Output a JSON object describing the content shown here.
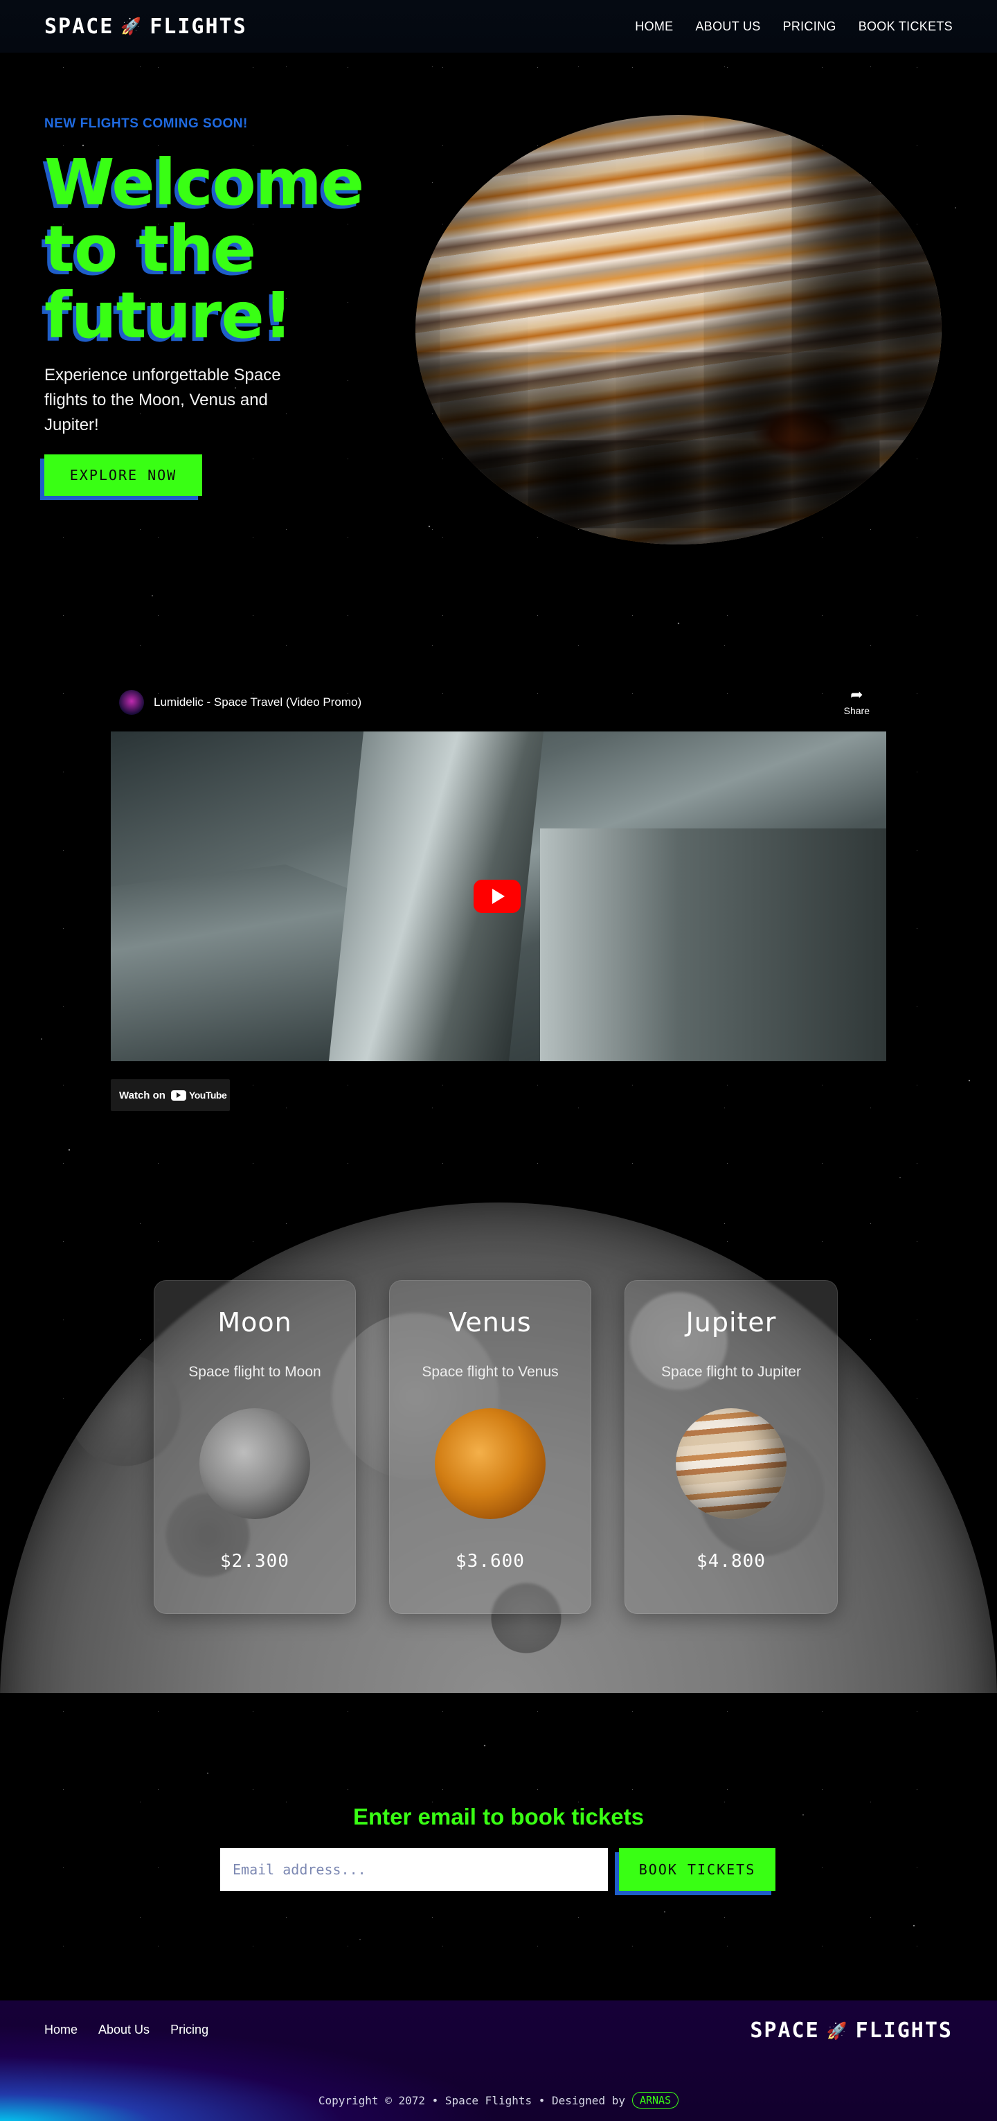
{
  "header": {
    "logo_left": "SPACE",
    "logo_right": "FLIGHTS",
    "logo_icon": "rocket-icon",
    "nav": [
      "HOME",
      "ABOUT US",
      "PRICING",
      "BOOK TICKETS"
    ]
  },
  "hero": {
    "eyebrow": "NEW FLIGHTS COMING SOON!",
    "title": "Welcome to the future!",
    "subtitle": "Experience unforgettable Space flights to the Moon, Venus and Jupiter!",
    "cta": "EXPLORE NOW"
  },
  "video": {
    "title": "Lumidelic - Space Travel (Video Promo)",
    "share": "Share",
    "watch_on": "Watch on",
    "youtube": "YouTube"
  },
  "pricing": {
    "cards": [
      {
        "name": "Moon",
        "description": "Space flight to Moon",
        "price": "$2.300"
      },
      {
        "name": "Venus",
        "description": "Space flight to Venus",
        "price": "$3.600"
      },
      {
        "name": "Jupiter",
        "description": "Space flight to Jupiter",
        "price": "$4.800"
      }
    ]
  },
  "booking": {
    "title": "Enter email to book tickets",
    "placeholder": "Email address...",
    "button": "BOOK TICKETS"
  },
  "footer": {
    "links": [
      "Home",
      "About Us",
      "Pricing"
    ],
    "logo_left": "SPACE",
    "logo_right": "FLIGHTS",
    "copyright": "Copyright © 2072 • Space Flights • Designed by",
    "designer": "ARNAS"
  },
  "colors": {
    "accent_green": "#39ff14",
    "accent_blue": "#1f5ec9",
    "footer_bg": "#160038"
  }
}
